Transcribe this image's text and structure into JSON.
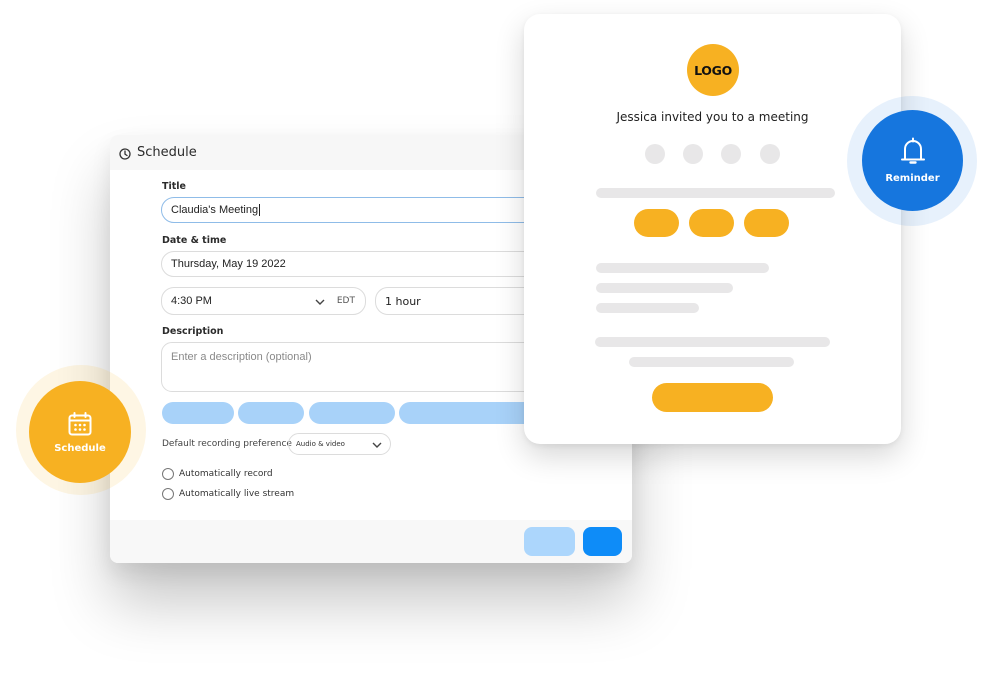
{
  "schedule_dialog": {
    "header": {
      "title": "Schedule",
      "icon": "clock-icon"
    },
    "title_field": {
      "label": "Title",
      "value": "Claudia's Meeting"
    },
    "datetime": {
      "label": "Date & time",
      "date_value": "Thursday, May 19 2022",
      "time_value": "4:30 PM",
      "timezone": "EDT",
      "duration_value": "1 hour"
    },
    "description": {
      "label": "Description",
      "placeholder": "Enter a description (optional)"
    },
    "recording": {
      "label": "Default recording preference",
      "selected": "Audio & video"
    },
    "options": [
      {
        "label": "Automatically record",
        "checked": false
      },
      {
        "label": "Automatically live stream",
        "checked": false
      }
    ]
  },
  "invite_card": {
    "logo_text": "LOGO",
    "message": "Jessica invited you to a meeting"
  },
  "badges": {
    "schedule": {
      "label": "Schedule",
      "icon": "calendar-icon"
    },
    "reminder": {
      "label": "Reminder",
      "icon": "bell-icon"
    }
  },
  "colors": {
    "accent_yellow": "#f7b122",
    "accent_blue": "#1676de",
    "primary_button": "#0e8cf8",
    "light_blue": "#a8d2f9",
    "skeleton_gray": "#e8e7e8"
  }
}
